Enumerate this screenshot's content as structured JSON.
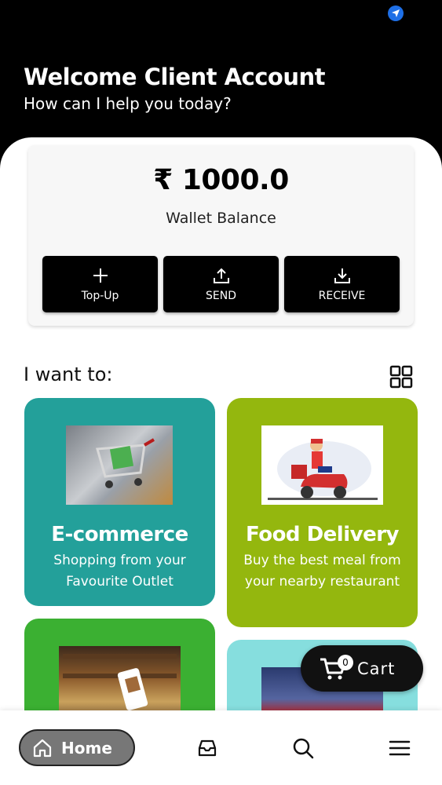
{
  "header": {
    "title": "Welcome Client Account",
    "subtitle": "How can I help you today?"
  },
  "wallet": {
    "amount": "₹ 1000.0",
    "label": "Wallet Balance",
    "buttons": [
      {
        "label": "Top-Up",
        "icon": "plus-icon"
      },
      {
        "label": "SEND",
        "icon": "upload-icon"
      },
      {
        "label": "RECEIVE",
        "icon": "download-icon"
      }
    ]
  },
  "section": {
    "title": "I want to:",
    "view_icon": "grid-view-icon"
  },
  "cards": [
    {
      "title": "E-commerce",
      "description": "Shopping from your Favourite Outlet",
      "color": "#23a09a"
    },
    {
      "title": "Food Delivery",
      "description": "Buy the best meal from your nearby restaurant",
      "color": "#94b70e"
    },
    {
      "title": "",
      "description": "",
      "color": "#3bb032"
    },
    {
      "title": "",
      "description": "",
      "color": "#86dede"
    }
  ],
  "cart": {
    "label": "Cart",
    "count": "0"
  },
  "nav": {
    "home_label": "Home",
    "items": [
      "home-icon",
      "inbox-icon",
      "search-icon",
      "menu-icon"
    ]
  },
  "colors": {
    "accent": "#000000",
    "status_icon": "#1e6fe6"
  }
}
